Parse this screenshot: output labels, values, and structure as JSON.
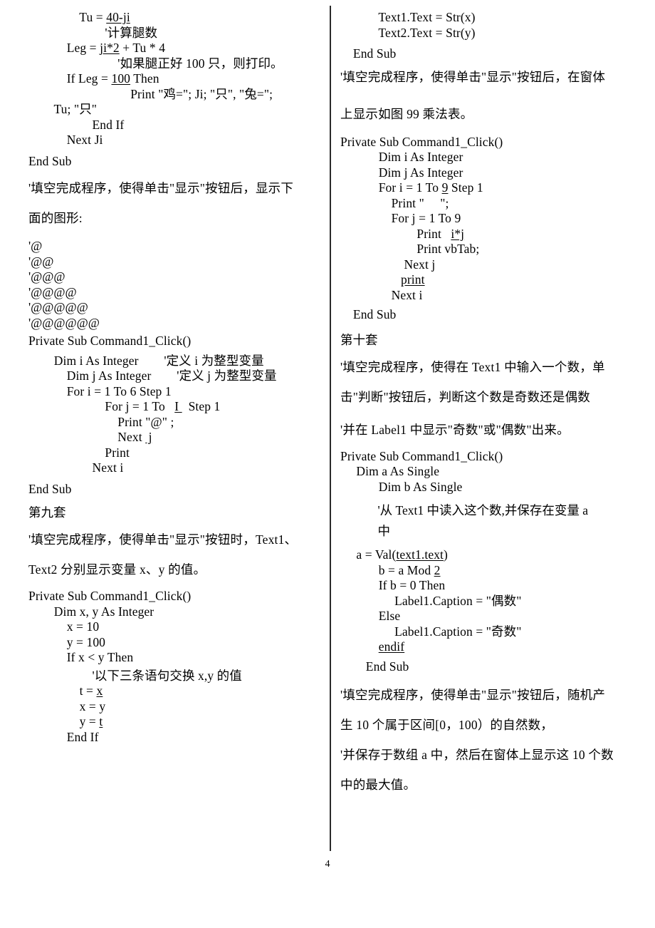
{
  "document": {
    "page_number": "4",
    "divider": "vertical-rule"
  },
  "left_column": {
    "lines": [
      {
        "id": "l1",
        "kind": "code",
        "text": "                Tu = ",
        "blank": "40-ji",
        "after": ""
      },
      {
        "id": "l2",
        "kind": "code",
        "text": "                        '计算腿数"
      },
      {
        "id": "l3",
        "kind": "code",
        "text": "            Leg = ",
        "blank": "ji*2",
        "after": " + Tu * 4"
      },
      {
        "id": "l4",
        "kind": "code",
        "text": "                            '如果腿正好 100 只，则打印。"
      },
      {
        "id": "l5",
        "kind": "code",
        "text": "            If Leg = ",
        "blank": "100",
        "after": " Then"
      },
      {
        "id": "l6",
        "kind": "code",
        "text": "                                Print \"鸡=\"; Ji; \"只\", \"兔=\";"
      },
      {
        "id": "l7",
        "kind": "code",
        "text": "        Tu; \"只\""
      },
      {
        "id": "l8",
        "kind": "code",
        "text": "                    End If"
      },
      {
        "id": "l9",
        "kind": "code",
        "text": "            Next Ji"
      },
      {
        "id": "l10",
        "kind": "code",
        "text": "End Sub"
      },
      {
        "id": "l11",
        "kind": "para",
        "text": "'填空完成程序，使得单击\"显示\"按钮后，显示下"
      },
      {
        "id": "l12",
        "kind": "para",
        "text": "面的图形:"
      },
      {
        "id": "l13",
        "kind": "art",
        "text": "'@"
      },
      {
        "id": "l14",
        "kind": "art",
        "text": "'@@"
      },
      {
        "id": "l15",
        "kind": "art",
        "text": "'@@@"
      },
      {
        "id": "l16",
        "kind": "art",
        "text": "'@@@@"
      },
      {
        "id": "l17",
        "kind": "art",
        "text": "'@@@@@"
      },
      {
        "id": "l18",
        "kind": "art",
        "text": "'@@@@@@"
      },
      {
        "id": "l19",
        "kind": "code",
        "text": "Private Sub Command1_Click()"
      },
      {
        "id": "l20",
        "kind": "code",
        "text": "        Dim i As Integer        '定义 i 为整型变量"
      },
      {
        "id": "l21",
        "kind": "code",
        "text": "            Dim j As Integer        '定义 j 为整型变量"
      },
      {
        "id": "l22",
        "kind": "code",
        "text": "            For i = 1 To 6 Step 1"
      },
      {
        "id": "l23",
        "kind": "code",
        "text": "                        For j = 1 To   ",
        "blank": "I ",
        "after": "  Step 1"
      },
      {
        "id": "l24",
        "kind": "code",
        "text": "                            Print \"@\" ;"
      },
      {
        "id": "l25",
        "kind": "code",
        "text": "                            Next ",
        "blank": " j",
        "after": ""
      },
      {
        "id": "l26",
        "kind": "code",
        "text": "                        Print"
      },
      {
        "id": "l27",
        "kind": "code",
        "text": "                    Next i"
      },
      {
        "id": "l28",
        "kind": "code",
        "text": "End Sub"
      },
      {
        "id": "l29",
        "kind": "heading",
        "text": "第九套"
      },
      {
        "id": "l30",
        "kind": "para",
        "text": "'填空完成程序，使得单击\"显示\"按钮时，Text1、"
      },
      {
        "id": "l31",
        "kind": "para",
        "text": "Text2 分别显示变量 x、y 的值。"
      },
      {
        "id": "l32",
        "kind": "code",
        "text": "Private Sub Command1_Click()"
      },
      {
        "id": "l33",
        "kind": "code",
        "text": "        Dim x, y As Integer"
      },
      {
        "id": "l34",
        "kind": "code",
        "text": "            x = 10"
      },
      {
        "id": "l35",
        "kind": "code",
        "text": "            y = 100"
      },
      {
        "id": "l36",
        "kind": "code",
        "text": "            If x < y Then"
      },
      {
        "id": "l37",
        "kind": "code",
        "text": "                    '以下三条语句交换 x,y 的值"
      },
      {
        "id": "l38",
        "kind": "code",
        "text": "                t = ",
        "blank": "x",
        "after": ""
      },
      {
        "id": "l39",
        "kind": "code",
        "text": "                x = y"
      },
      {
        "id": "l40",
        "kind": "code",
        "text": "                y = ",
        "blank": "t",
        "after": ""
      },
      {
        "id": "l41",
        "kind": "code",
        "text": "            End If"
      }
    ]
  },
  "right_column": {
    "lines": [
      {
        "id": "r1",
        "kind": "code",
        "text": "            Text1.Text = Str(x)"
      },
      {
        "id": "r2",
        "kind": "code",
        "text": "            Text2.Text = Str(y)"
      },
      {
        "id": "r3",
        "kind": "code",
        "text": "    End Sub"
      },
      {
        "id": "r4",
        "kind": "para",
        "text": "'填空完成程序，使得单击\"显示\"按钮后，在窗体"
      },
      {
        "id": "r5",
        "kind": "para",
        "text": "上显示如图 99 乘法表。"
      },
      {
        "id": "r6",
        "kind": "code",
        "text": "Private Sub Command1_Click()"
      },
      {
        "id": "r7",
        "kind": "code",
        "text": "            Dim i As Integer"
      },
      {
        "id": "r8",
        "kind": "code",
        "text": "            Dim j As Integer"
      },
      {
        "id": "r9",
        "kind": "code",
        "text": "            For i = 1 To ",
        "blank": "9",
        "after": " Step 1"
      },
      {
        "id": "r10",
        "kind": "code",
        "text": "                Print \"     \";"
      },
      {
        "id": "r11",
        "kind": "code",
        "text": "                For j = 1 To 9"
      },
      {
        "id": "r12",
        "kind": "code",
        "text": "                        Print   ",
        "blank": "i*j",
        "after": ""
      },
      {
        "id": "r13",
        "kind": "code",
        "text": "                        Print vbTab;"
      },
      {
        "id": "r14",
        "kind": "code",
        "text": "                    Next j"
      },
      {
        "id": "r15",
        "kind": "code",
        "text": "                   ",
        "blank": "print",
        "after": ""
      },
      {
        "id": "r16",
        "kind": "code",
        "text": "                Next i"
      },
      {
        "id": "r17",
        "kind": "code",
        "text": "    End Sub"
      },
      {
        "id": "r18",
        "kind": "heading",
        "text": "第十套"
      },
      {
        "id": "r19",
        "kind": "para",
        "text": "'填空完成程序，使得在 Text1 中输入一个数，单"
      },
      {
        "id": "r20",
        "kind": "para",
        "text": "击\"判断\"按钮后，判断这个数是奇数还是偶数"
      },
      {
        "id": "r21",
        "kind": "para",
        "text": "'并在 Label1 中显示\"奇数\"或\"偶数\"出来。"
      },
      {
        "id": "r22",
        "kind": "code",
        "text": "Private Sub Command1_Click()"
      },
      {
        "id": "r23",
        "kind": "code",
        "text": "     Dim a As Single"
      },
      {
        "id": "r24",
        "kind": "code",
        "text": "            Dim b As Single"
      },
      {
        "id": "r25",
        "kind": "para-tight",
        "text": "            '从 Text1 中读入这个数,并保存在变量 a"
      },
      {
        "id": "r26",
        "kind": "para-tight",
        "text": "            中"
      },
      {
        "id": "r27",
        "kind": "code",
        "text": "     a = Val(",
        "blank": "text1.text",
        "after": ")"
      },
      {
        "id": "r28",
        "kind": "code",
        "text": "            b = a Mod ",
        "blank": "2",
        "after": ""
      },
      {
        "id": "r29",
        "kind": "code",
        "text": "            If b = 0 Then"
      },
      {
        "id": "r30",
        "kind": "code",
        "text": "                 Label1.Caption = \"偶数\""
      },
      {
        "id": "r31",
        "kind": "code",
        "text": "            Else"
      },
      {
        "id": "r32",
        "kind": "code",
        "text": "                 Label1.Caption = \"奇数\""
      },
      {
        "id": "r33",
        "kind": "code",
        "text": "            ",
        "blank": "endif",
        "after": ""
      },
      {
        "id": "r34",
        "kind": "code",
        "text": "        End Sub"
      },
      {
        "id": "r35",
        "kind": "para",
        "text": "'填空完成程序，使得单击\"显示\"按钮后，随机产"
      },
      {
        "id": "r36",
        "kind": "para",
        "text": "生 10 个属于区间[0，100）的自然数，"
      },
      {
        "id": "r37",
        "kind": "para",
        "text": "'并保存于数组 a 中，然后在窗体上显示这 10 个数"
      },
      {
        "id": "r38",
        "kind": "para",
        "text": "中的最大值。"
      }
    ]
  }
}
